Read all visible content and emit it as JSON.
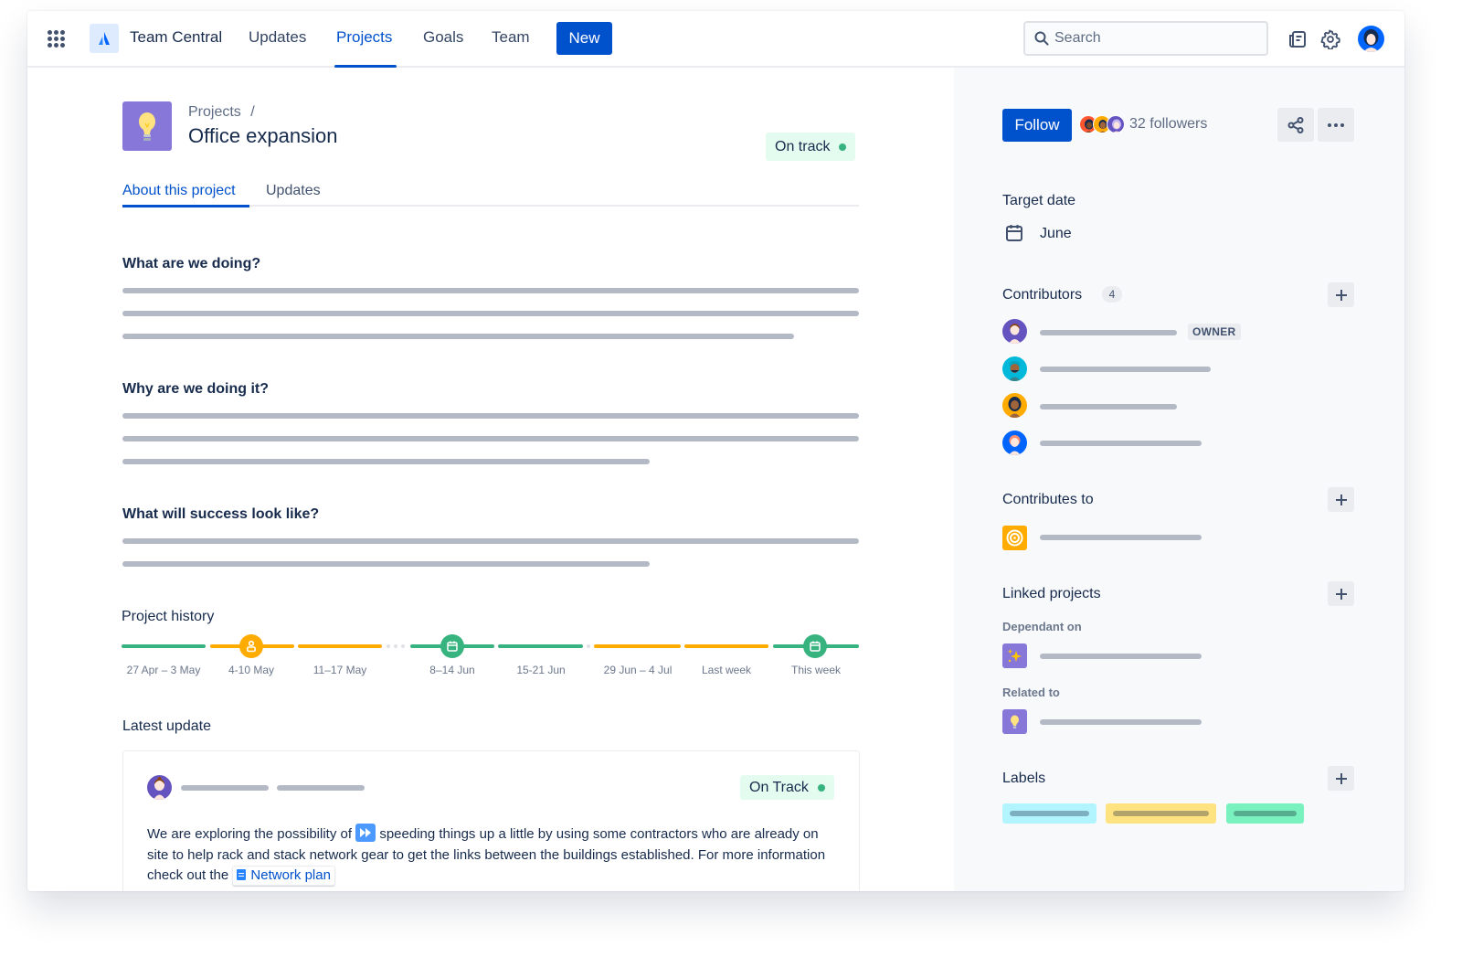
{
  "nav": {
    "product_name": "Team Central",
    "items": [
      {
        "label": "Updates",
        "active": false
      },
      {
        "label": "Projects",
        "active": true
      },
      {
        "label": "Goals",
        "active": false
      },
      {
        "label": "Team",
        "active": false
      }
    ],
    "new_label": "New",
    "search_placeholder": "Search",
    "icons": [
      "app-switcher-icon",
      "atlassian-logo-icon",
      "search-icon",
      "feedback-icon",
      "settings-icon",
      "profile-avatar"
    ]
  },
  "project": {
    "breadcrumb": "Projects",
    "breadcrumb_sep": "/",
    "title": "Office expansion",
    "status": "On track",
    "status_color": "#36b37e",
    "icon": "lightbulb-icon",
    "icon_bg": "#8777d9"
  },
  "tabs": [
    {
      "label": "About this project",
      "active": true
    },
    {
      "label": "Updates",
      "active": false
    }
  ],
  "about": [
    {
      "question": "What are we doing?",
      "placeholder_lines": 3
    },
    {
      "question": "Why are we doing it?",
      "placeholder_lines": 3
    },
    {
      "question": "What will success look like?",
      "placeholder_lines": 2
    }
  ],
  "history": {
    "title": "Project history",
    "weeks": [
      {
        "label": "27 Apr – 3 May",
        "status": "on-track"
      },
      {
        "label": "4-10 May",
        "status": "at-risk",
        "milestone": "owner-change-icon"
      },
      {
        "label": "11–17 May",
        "status": "at-risk"
      },
      {
        "label": "8–14 Jun",
        "status": "on-track",
        "milestone": "date-change-icon"
      },
      {
        "label": "15-21 Jun",
        "status": "on-track"
      },
      {
        "label": "29 Jun – 4 Jul",
        "status": "at-risk"
      },
      {
        "label": "Last week",
        "status": "at-risk"
      },
      {
        "label": "This week",
        "status": "on-track",
        "milestone": "date-change-icon"
      }
    ],
    "colors": {
      "on-track": "#36b37e",
      "at-risk": "#ffab00"
    }
  },
  "latest_update": {
    "title": "Latest update",
    "status": "On Track",
    "text_before_emoji": "We are exploring the possibility of ",
    "text_after_emoji": " speeding things up a little by using some contractors who are already on site to help rack and stack network gear to get the links between the buildings established. For more information check out the ",
    "link_label": "Network plan"
  },
  "sidebar": {
    "follow_label": "Follow",
    "followers": "32 followers",
    "target_date_label": "Target date",
    "target_date": "June",
    "contributors_label": "Contributors",
    "contributors_count": "4",
    "owner_label": "OWNER",
    "contributes_to_label": "Contributes to",
    "linked_projects_label": "Linked projects",
    "dependant_on_label": "Dependant on",
    "related_to_label": "Related to",
    "labels_label": "Labels",
    "label_colors": [
      "#b3f5ff",
      "#ffe380",
      "#79f2c0"
    ]
  }
}
